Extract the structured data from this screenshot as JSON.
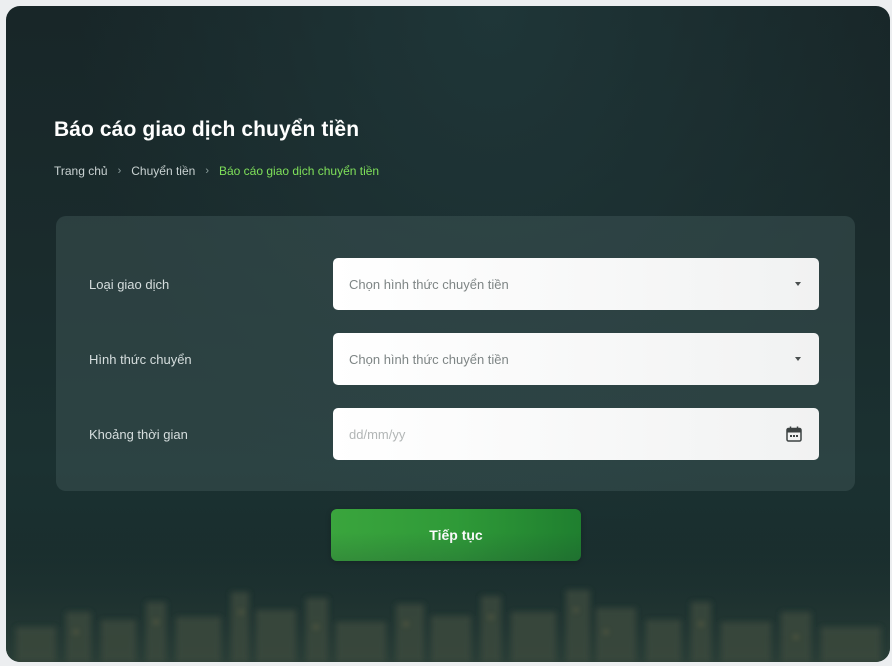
{
  "page": {
    "title": "Báo cáo giao dịch chuyển tiền"
  },
  "breadcrumb": {
    "items": [
      "Trang chủ",
      "Chuyển tiền"
    ],
    "current": "Báo cáo giao dịch chuyển tiền",
    "separator": "›"
  },
  "form": {
    "fields": [
      {
        "label": "Loại giao dịch",
        "placeholder": "Chọn hình thức chuyển tiền",
        "icon": "chevron-down-icon"
      },
      {
        "label": "Hình thức chuyển",
        "placeholder": "Chọn hình thức chuyển tiền",
        "icon": "chevron-down-icon"
      },
      {
        "label": "Khoảng thời gian",
        "placeholder": "dd/mm/yy",
        "icon": "calendar-icon"
      }
    ],
    "submit_label": "Tiếp tục"
  },
  "colors": {
    "accent": "#7fe05a",
    "button": "#2f9a38",
    "background": "#1a2c2d"
  }
}
